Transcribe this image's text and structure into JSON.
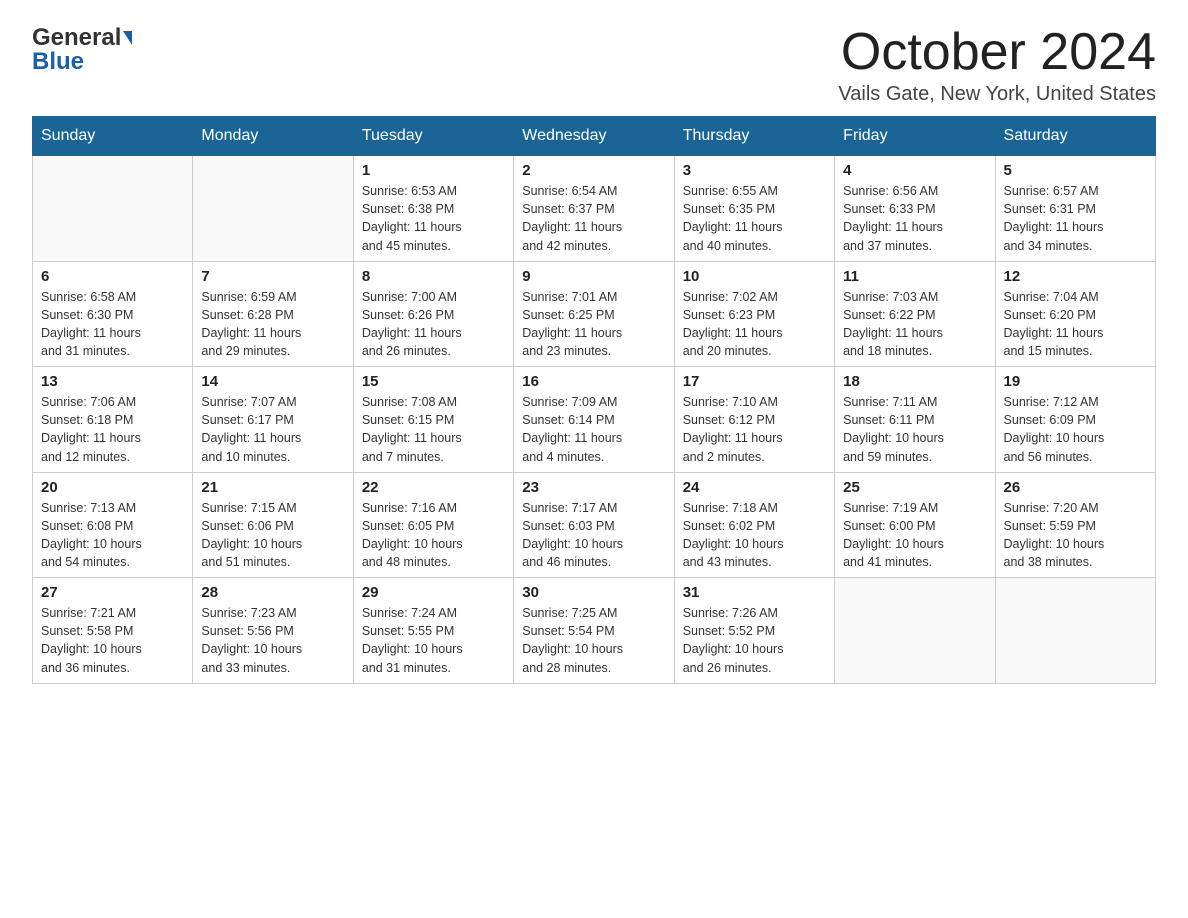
{
  "header": {
    "logo_general": "General",
    "logo_blue": "Blue",
    "month_title": "October 2024",
    "location": "Vails Gate, New York, United States"
  },
  "columns": [
    "Sunday",
    "Monday",
    "Tuesday",
    "Wednesday",
    "Thursday",
    "Friday",
    "Saturday"
  ],
  "weeks": [
    [
      {
        "day": "",
        "info": ""
      },
      {
        "day": "",
        "info": ""
      },
      {
        "day": "1",
        "info": "Sunrise: 6:53 AM\nSunset: 6:38 PM\nDaylight: 11 hours\nand 45 minutes."
      },
      {
        "day": "2",
        "info": "Sunrise: 6:54 AM\nSunset: 6:37 PM\nDaylight: 11 hours\nand 42 minutes."
      },
      {
        "day": "3",
        "info": "Sunrise: 6:55 AM\nSunset: 6:35 PM\nDaylight: 11 hours\nand 40 minutes."
      },
      {
        "day": "4",
        "info": "Sunrise: 6:56 AM\nSunset: 6:33 PM\nDaylight: 11 hours\nand 37 minutes."
      },
      {
        "day": "5",
        "info": "Sunrise: 6:57 AM\nSunset: 6:31 PM\nDaylight: 11 hours\nand 34 minutes."
      }
    ],
    [
      {
        "day": "6",
        "info": "Sunrise: 6:58 AM\nSunset: 6:30 PM\nDaylight: 11 hours\nand 31 minutes."
      },
      {
        "day": "7",
        "info": "Sunrise: 6:59 AM\nSunset: 6:28 PM\nDaylight: 11 hours\nand 29 minutes."
      },
      {
        "day": "8",
        "info": "Sunrise: 7:00 AM\nSunset: 6:26 PM\nDaylight: 11 hours\nand 26 minutes."
      },
      {
        "day": "9",
        "info": "Sunrise: 7:01 AM\nSunset: 6:25 PM\nDaylight: 11 hours\nand 23 minutes."
      },
      {
        "day": "10",
        "info": "Sunrise: 7:02 AM\nSunset: 6:23 PM\nDaylight: 11 hours\nand 20 minutes."
      },
      {
        "day": "11",
        "info": "Sunrise: 7:03 AM\nSunset: 6:22 PM\nDaylight: 11 hours\nand 18 minutes."
      },
      {
        "day": "12",
        "info": "Sunrise: 7:04 AM\nSunset: 6:20 PM\nDaylight: 11 hours\nand 15 minutes."
      }
    ],
    [
      {
        "day": "13",
        "info": "Sunrise: 7:06 AM\nSunset: 6:18 PM\nDaylight: 11 hours\nand 12 minutes."
      },
      {
        "day": "14",
        "info": "Sunrise: 7:07 AM\nSunset: 6:17 PM\nDaylight: 11 hours\nand 10 minutes."
      },
      {
        "day": "15",
        "info": "Sunrise: 7:08 AM\nSunset: 6:15 PM\nDaylight: 11 hours\nand 7 minutes."
      },
      {
        "day": "16",
        "info": "Sunrise: 7:09 AM\nSunset: 6:14 PM\nDaylight: 11 hours\nand 4 minutes."
      },
      {
        "day": "17",
        "info": "Sunrise: 7:10 AM\nSunset: 6:12 PM\nDaylight: 11 hours\nand 2 minutes."
      },
      {
        "day": "18",
        "info": "Sunrise: 7:11 AM\nSunset: 6:11 PM\nDaylight: 10 hours\nand 59 minutes."
      },
      {
        "day": "19",
        "info": "Sunrise: 7:12 AM\nSunset: 6:09 PM\nDaylight: 10 hours\nand 56 minutes."
      }
    ],
    [
      {
        "day": "20",
        "info": "Sunrise: 7:13 AM\nSunset: 6:08 PM\nDaylight: 10 hours\nand 54 minutes."
      },
      {
        "day": "21",
        "info": "Sunrise: 7:15 AM\nSunset: 6:06 PM\nDaylight: 10 hours\nand 51 minutes."
      },
      {
        "day": "22",
        "info": "Sunrise: 7:16 AM\nSunset: 6:05 PM\nDaylight: 10 hours\nand 48 minutes."
      },
      {
        "day": "23",
        "info": "Sunrise: 7:17 AM\nSunset: 6:03 PM\nDaylight: 10 hours\nand 46 minutes."
      },
      {
        "day": "24",
        "info": "Sunrise: 7:18 AM\nSunset: 6:02 PM\nDaylight: 10 hours\nand 43 minutes."
      },
      {
        "day": "25",
        "info": "Sunrise: 7:19 AM\nSunset: 6:00 PM\nDaylight: 10 hours\nand 41 minutes."
      },
      {
        "day": "26",
        "info": "Sunrise: 7:20 AM\nSunset: 5:59 PM\nDaylight: 10 hours\nand 38 minutes."
      }
    ],
    [
      {
        "day": "27",
        "info": "Sunrise: 7:21 AM\nSunset: 5:58 PM\nDaylight: 10 hours\nand 36 minutes."
      },
      {
        "day": "28",
        "info": "Sunrise: 7:23 AM\nSunset: 5:56 PM\nDaylight: 10 hours\nand 33 minutes."
      },
      {
        "day": "29",
        "info": "Sunrise: 7:24 AM\nSunset: 5:55 PM\nDaylight: 10 hours\nand 31 minutes."
      },
      {
        "day": "30",
        "info": "Sunrise: 7:25 AM\nSunset: 5:54 PM\nDaylight: 10 hours\nand 28 minutes."
      },
      {
        "day": "31",
        "info": "Sunrise: 7:26 AM\nSunset: 5:52 PM\nDaylight: 10 hours\nand 26 minutes."
      },
      {
        "day": "",
        "info": ""
      },
      {
        "day": "",
        "info": ""
      }
    ]
  ]
}
